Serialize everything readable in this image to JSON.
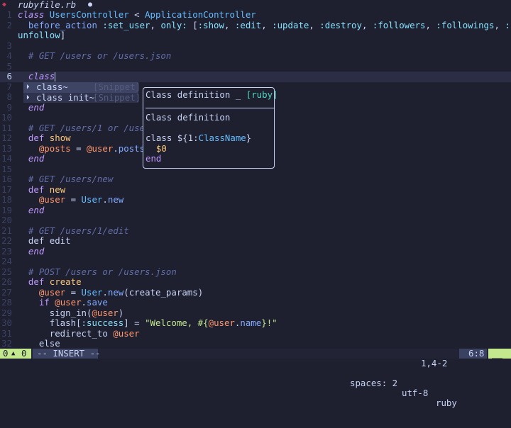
{
  "tab": {
    "icon": "ruby-gem-icon",
    "filename": "rubyfile.rb",
    "modified_marker": "●"
  },
  "lines": [
    {
      "n": "1",
      "html": "<span class=\"kwi\">class</span> <span class=\"type\">UsersController</span> <span class=\"plain\">&lt;</span> <span class=\"type\">ApplicationController</span>"
    },
    {
      "n": "2",
      "html": "  <span class=\"fn\">before_action</span> <span class=\"sym2\">:set_user</span>, <span class=\"sym2\">only:</span> [<span class=\"sym2\">:show</span>, <span class=\"sym2\">:edit</span>, <span class=\"sym2\">:update</span>, <span class=\"sym2\">:destroy</span>, <span class=\"sym2\">:followers</span>, <span class=\"sym2\">:followings</span>, <span class=\"sym2\">:follow</span>, <span class=\"sym2\">:</span>"
    },
    {
      "n": "",
      "html": "<span class=\"sym2\">unfollow</span>]"
    },
    {
      "n": "3",
      "html": ""
    },
    {
      "n": "4",
      "html": "  <span class=\"cmt\"># GET /users or /users.json</span>"
    },
    {
      "n": "5",
      "html": ""
    },
    {
      "n": "6",
      "html": "  <span class=\"kwi\">class</span><span class=\"cursor\"></span>",
      "current": true
    },
    {
      "n": "7",
      "html": ""
    },
    {
      "n": "8",
      "html": ""
    },
    {
      "n": "9",
      "html": "  <span class=\"kwi\">end</span>"
    },
    {
      "n": "10",
      "html": ""
    },
    {
      "n": "11",
      "html": "  <span class=\"cmt\"># GET /users/1 or /users</span>"
    },
    {
      "n": "12",
      "html": "  <span class=\"kw\">def</span> <span class=\"meth\">show</span>"
    },
    {
      "n": "13",
      "html": "    <span class=\"ivar\">@posts</span> = <span class=\"ivar\">@user</span>.<span class=\"fn\">posts</span>"
    },
    {
      "n": "14",
      "html": "  <span class=\"kwi\">end</span>"
    },
    {
      "n": "15",
      "html": ""
    },
    {
      "n": "16",
      "html": "  <span class=\"cmt\"># GET /users/new</span>"
    },
    {
      "n": "17",
      "html": "  <span class=\"kw\">def</span> <span class=\"meth\">new</span>"
    },
    {
      "n": "18",
      "html": "    <span class=\"ivar\">@user</span> = <span class=\"type\">User</span>.<span class=\"fn\">new</span>"
    },
    {
      "n": "19",
      "html": "  <span class=\"kwi\">end</span>"
    },
    {
      "n": "20",
      "html": ""
    },
    {
      "n": "21",
      "html": "  <span class=\"cmt\"># GET /users/1/edit</span>"
    },
    {
      "n": "22",
      "html": "  <span class=\"plain\">def edit</span>"
    },
    {
      "n": "23",
      "html": "  <span class=\"kwi\">end</span>"
    },
    {
      "n": "24",
      "html": ""
    },
    {
      "n": "25",
      "html": "  <span class=\"cmt\"># POST /users or /users.json</span>"
    },
    {
      "n": "26",
      "html": "  <span class=\"kw\">def</span> <span class=\"meth\">create</span>"
    },
    {
      "n": "27",
      "html": "    <span class=\"ivar\">@user</span> = <span class=\"type\">User</span>.<span class=\"fn\">new</span>(<span class=\"plain\">create_params</span>)"
    },
    {
      "n": "28",
      "html": "    <span class=\"kw\">if</span> <span class=\"ivar\">@user</span>.<span class=\"fn\">save</span>"
    },
    {
      "n": "29",
      "html": "      <span class=\"plain\">sign_in</span>(<span class=\"ivar\">@user</span>)"
    },
    {
      "n": "30",
      "html": "      <span class=\"plain\">flash</span>[<span class=\"sym2\">:success</span>] = <span class=\"str\">\"Welcome, #{</span><span class=\"ivar\">@user</span>.<span class=\"fn\">name</span><span class=\"str\">}!\"</span>"
    },
    {
      "n": "31",
      "html": "      <span class=\"plain\">redirect_to</span> <span class=\"ivar\">@user</span>"
    },
    {
      "n": "32",
      "html": "    <span class=\"plain\">else</span>"
    }
  ],
  "completion": {
    "items": [
      {
        "icon": "⏵",
        "word": "class~",
        "kind": "[Snippet]",
        "selected": true
      },
      {
        "icon": "⏵",
        "word": "class init~",
        "kind": "[Snippet]",
        "selected": false
      }
    ]
  },
  "doc": {
    "title": "Class definition _ ",
    "lang": "[ruby]",
    "description": "Class definition",
    "body_l1_a": "class ${1:",
    "body_l1_b": "ClassName",
    "body_l1_c": "}",
    "body_l2": "  $0",
    "body_l3": "end"
  },
  "statusline": {
    "errors": "0",
    "warn_icon": "▲",
    "warnings": "0",
    "mode": "-- INSERT --",
    "spaces": "spaces: 2",
    "encoding": "utf-8",
    "filetype": "ruby",
    "position": "6:8",
    "end_marker": "__"
  },
  "cmdline": {
    "position": "1,4-2"
  }
}
